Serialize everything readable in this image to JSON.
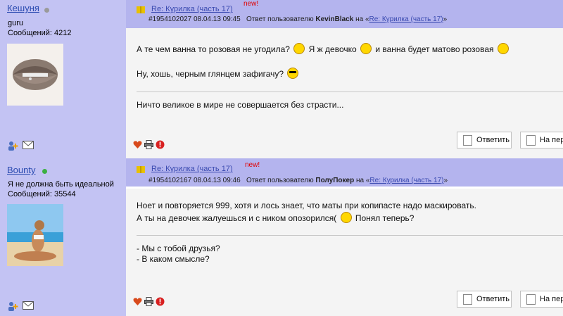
{
  "posts": [
    {
      "author": "Кешуня",
      "status": "guru",
      "messages": "Сообщений: 4212",
      "title_link": "Re: Курилка (часть 17)",
      "new_label": "new!",
      "post_number": "#1954102027 08.04.13 09:45",
      "reply_to": "Ответ пользователю",
      "reply_user": "KevinBlack",
      "reply_on": "на «",
      "reply_link": "Re: Курилка (часть 17)",
      "reply_end": "»",
      "line1_a": "А те чем ванна то розовая не угодила?",
      "line1_b": "Я ж девочко",
      "line1_c": "и ванна будет матово розовая",
      "line2": "Ну, хошь, черным глянцем зафигачу?",
      "signature": "Ничто великое в мире не совершается без страсти...",
      "reply_button": "Ответить",
      "quote_button": "На перв"
    },
    {
      "author": "Bounty",
      "status": "Я не должна быть идеальной",
      "messages": "Сообщений: 35544",
      "title_link": "Re: Курилка (часть 17)",
      "new_label": "new!",
      "post_number": "#1954102167 08.04.13 09:46",
      "reply_to": "Ответ пользователю",
      "reply_user": "ПолуПокер",
      "reply_on": "на «",
      "reply_link": "Re: Курилка (часть 17)",
      "reply_end": "»",
      "line1": "Ноет и повторяется 999, хотя и лось знает, что маты при копипасте надо маскировать.",
      "line2_a": "А ты на девочек жалуешься и с ником опозорился(",
      "line2_b": "Понял теперь?",
      "sig1": "- Мы с тобой друзья?",
      "sig2": "- В каком смысле?",
      "reply_button": "Ответить",
      "quote_button": "На перв"
    }
  ],
  "colors": {
    "sidebar": "#c3c3f3",
    "header": "#b4b4ee",
    "body": "#f4f4f4",
    "link": "#2a4ab0",
    "new": "#e00000",
    "online": "#3cb043",
    "offline": "#9a9a9a"
  },
  "icons": [
    "add-friend-icon",
    "mail-icon",
    "heart-icon",
    "print-icon",
    "warning-icon",
    "book-icon",
    "reply-icon",
    "smiley-icon",
    "cool-smiley-icon"
  ]
}
